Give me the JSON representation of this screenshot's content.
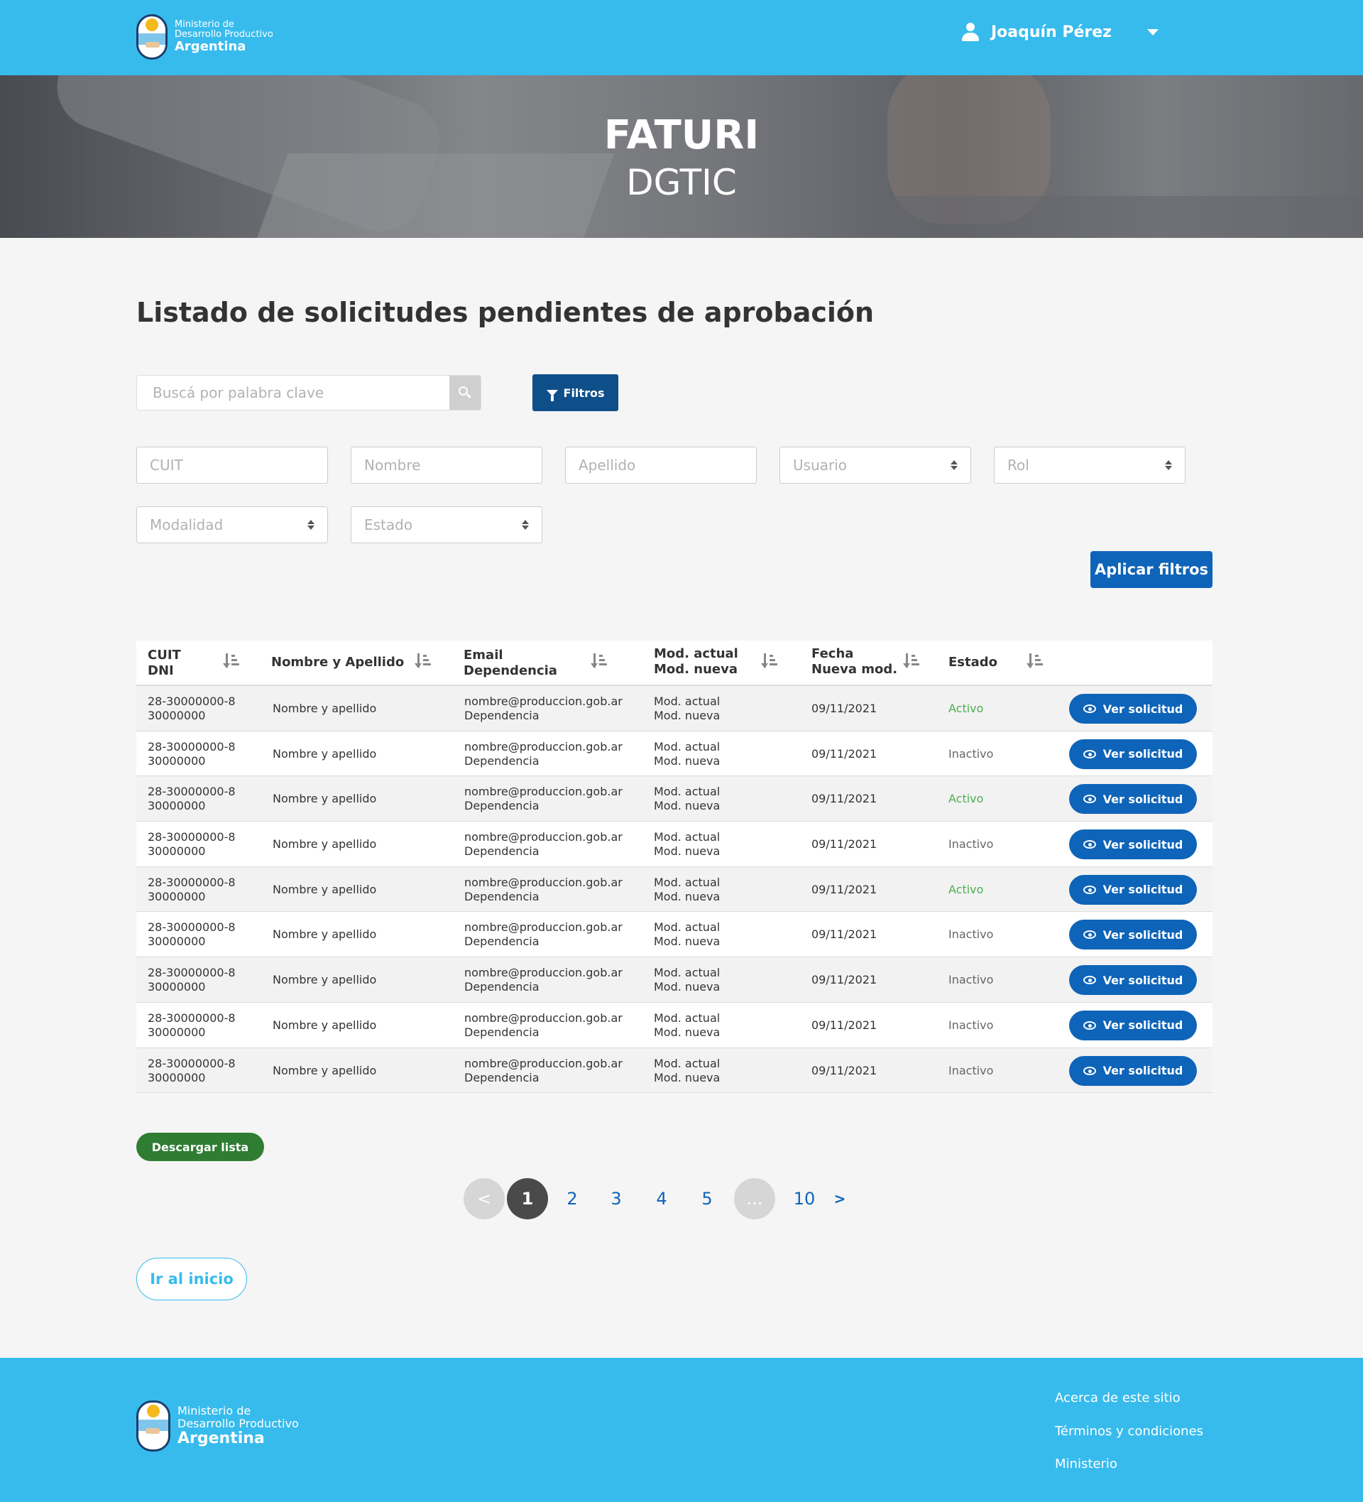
{
  "header": {
    "logo": {
      "line1": "Ministerio de",
      "line2": "Desarrollo Productivo",
      "line3": "Argentina"
    },
    "user_name": "Joaquín Pérez"
  },
  "hero": {
    "title": "FATURI",
    "subtitle": "DGTIC"
  },
  "main": {
    "title": "Listado de solicitudes pendientes de aprobación",
    "search_placeholder": "Buscá por palabra clave",
    "filtros_label": "Filtros",
    "filters": {
      "cuit": "CUIT",
      "nombre": "Nombre",
      "apellido": "Apellido",
      "usuario": "Usuario",
      "rol": "Rol",
      "modalidad": "Modalidad",
      "estado": "Estado"
    },
    "aplicar_label": "Aplicar filtros"
  },
  "table": {
    "headers": {
      "cuit_1": "CUIT",
      "cuit_2": "DNI",
      "nombre": "Nombre y Apellido",
      "email_1": "Email",
      "email_2": "Dependencia",
      "mod_1": "Mod. actual",
      "mod_2": "Mod. nueva",
      "fecha_1": "Fecha",
      "fecha_2": "Nueva mod.",
      "estado": "Estado"
    },
    "rows": [
      {
        "cuit": "28-30000000-8",
        "dni": "30000000",
        "nombre": "Nombre y apellido",
        "email": "nombre@produccion.gob.ar",
        "dependencia": "Dependencia",
        "mod_actual": "Mod. actual",
        "mod_nueva": "Mod. nueva",
        "fecha": "09/11/2021",
        "estado": "Activo",
        "accion": "Ver solicitud"
      },
      {
        "cuit": "28-30000000-8",
        "dni": "30000000",
        "nombre": "Nombre y apellido",
        "email": "nombre@produccion.gob.ar",
        "dependencia": "Dependencia",
        "mod_actual": "Mod. actual",
        "mod_nueva": "Mod. nueva",
        "fecha": "09/11/2021",
        "estado": "Inactivo",
        "accion": "Ver solicitud"
      },
      {
        "cuit": "28-30000000-8",
        "dni": "30000000",
        "nombre": "Nombre y apellido",
        "email": "nombre@produccion.gob.ar",
        "dependencia": "Dependencia",
        "mod_actual": "Mod. actual",
        "mod_nueva": "Mod. nueva",
        "fecha": "09/11/2021",
        "estado": "Activo",
        "accion": "Ver solicitud"
      },
      {
        "cuit": "28-30000000-8",
        "dni": "30000000",
        "nombre": "Nombre y apellido",
        "email": "nombre@produccion.gob.ar",
        "dependencia": "Dependencia",
        "mod_actual": "Mod. actual",
        "mod_nueva": "Mod. nueva",
        "fecha": "09/11/2021",
        "estado": "Inactivo",
        "accion": "Ver solicitud"
      },
      {
        "cuit": "28-30000000-8",
        "dni": "30000000",
        "nombre": "Nombre y apellido",
        "email": "nombre@produccion.gob.ar",
        "dependencia": "Dependencia",
        "mod_actual": "Mod. actual",
        "mod_nueva": "Mod. nueva",
        "fecha": "09/11/2021",
        "estado": "Activo",
        "accion": "Ver solicitud"
      },
      {
        "cuit": "28-30000000-8",
        "dni": "30000000",
        "nombre": "Nombre y apellido",
        "email": "nombre@produccion.gob.ar",
        "dependencia": "Dependencia",
        "mod_actual": "Mod. actual",
        "mod_nueva": "Mod. nueva",
        "fecha": "09/11/2021",
        "estado": "Inactivo",
        "accion": "Ver solicitud"
      },
      {
        "cuit": "28-30000000-8",
        "dni": "30000000",
        "nombre": "Nombre y apellido",
        "email": "nombre@produccion.gob.ar",
        "dependencia": "Dependencia",
        "mod_actual": "Mod. actual",
        "mod_nueva": "Mod. nueva",
        "fecha": "09/11/2021",
        "estado": "Inactivo",
        "accion": "Ver solicitud"
      },
      {
        "cuit": "28-30000000-8",
        "dni": "30000000",
        "nombre": "Nombre y apellido",
        "email": "nombre@produccion.gob.ar",
        "dependencia": "Dependencia",
        "mod_actual": "Mod. actual",
        "mod_nueva": "Mod. nueva",
        "fecha": "09/11/2021",
        "estado": "Inactivo",
        "accion": "Ver solicitud"
      },
      {
        "cuit": "28-30000000-8",
        "dni": "30000000",
        "nombre": "Nombre y apellido",
        "email": "nombre@produccion.gob.ar",
        "dependencia": "Dependencia",
        "mod_actual": "Mod. actual",
        "mod_nueva": "Mod. nueva",
        "fecha": "09/11/2021",
        "estado": "Inactivo",
        "accion": "Ver solicitud"
      }
    ]
  },
  "actions": {
    "descargar": "Descargar lista",
    "inicio": "Ir al inicio"
  },
  "pagination": {
    "prev": "<",
    "pages": [
      "1",
      "2",
      "3",
      "4",
      "5",
      "...",
      "10"
    ],
    "current": "1",
    "next": ">"
  },
  "footer": {
    "logo": {
      "line1": "Ministerio de",
      "line2": "Desarrollo Productivo",
      "line3": "Argentina"
    },
    "links": [
      "Acerca de este sitio",
      "Términos y condiciones",
      "Ministerio"
    ]
  },
  "colors": {
    "brand": "#37bbed",
    "primary_button": "#0e64b8",
    "filtros_button": "#0e4f8a",
    "download_button": "#2e7d32",
    "status_active": "#4caf50"
  }
}
